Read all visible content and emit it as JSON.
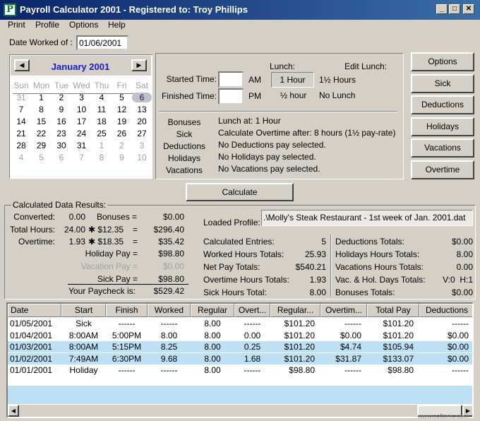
{
  "window": {
    "title": "Payroll Calculator 2001 - Registered to: Troy Phillips",
    "logo": "P"
  },
  "menu": [
    "Print",
    "Profile",
    "Options",
    "Help"
  ],
  "date_worked": {
    "label": "Date Worked of :",
    "value": "01/06/2001"
  },
  "calendar": {
    "month": "January 2001",
    "days_of_week": [
      "Sun",
      "Mon",
      "Tue",
      "Wed",
      "Thu",
      "Fri",
      "Sat"
    ],
    "weeks": [
      [
        "31",
        "1",
        "2",
        "3",
        "4",
        "5",
        "6"
      ],
      [
        "7",
        "8",
        "9",
        "10",
        "11",
        "12",
        "13"
      ],
      [
        "14",
        "15",
        "16",
        "17",
        "18",
        "19",
        "20"
      ],
      [
        "21",
        "22",
        "23",
        "24",
        "25",
        "26",
        "27"
      ],
      [
        "28",
        "29",
        "30",
        "31",
        "1",
        "2",
        "3"
      ],
      [
        "4",
        "5",
        "6",
        "7",
        "8",
        "9",
        "10"
      ]
    ],
    "selected": "6"
  },
  "time": {
    "started_label": "Started Time:",
    "finished_label": "Finished Time:",
    "am": "AM",
    "pm": "PM",
    "started_value": "",
    "finished_value": "",
    "lunch_label": "Lunch:",
    "edit_lunch_label": "Edit Lunch:",
    "lunch_options": [
      "1 Hour",
      "1½ Hours",
      "½ hour",
      "No Lunch"
    ]
  },
  "summary": {
    "labels": [
      "Bonuses",
      "Sick",
      "Deductions",
      "Holidays",
      "Vacations"
    ],
    "lines": [
      "Lunch at: 1 Hour",
      "Calculate Overtime after: 8 hours (1½ pay-rate)",
      "No Deductions pay selected.",
      "No Holidays pay selected.",
      "No Vacations pay selected."
    ]
  },
  "side_buttons": [
    "Options",
    "Sick",
    "Deductions",
    "Holidays",
    "Vacations",
    "Overtime"
  ],
  "calculate_label": "Calculate",
  "results": {
    "title": "Calculated Data Results:",
    "converted_label": "Converted:",
    "converted": "0.00",
    "bonuses_label": "Bonuses =",
    "bonuses": "$0.00",
    "total_hours_label": "Total Hours:",
    "total_hours": "24.00",
    "rate": "✱ $12.35",
    "eq": "=",
    "total_hours_pay": "$296.40",
    "overtime_label": "Overtime:",
    "overtime": "1.93",
    "ot_rate": "✱ $18.35",
    "overtime_pay": "$35.42",
    "holiday_label": "Holiday Pay =",
    "holiday": "$98.80",
    "vacation_label": "Vacation Pay =",
    "vacation": "$0.00",
    "sick_label": "Sick Pay =",
    "sick": "$98.80",
    "paycheck_label": "Your Paycheck is:",
    "paycheck": "$529.42"
  },
  "profile": {
    "label": "Loaded Profile:",
    "value": ".\\Molly's Steak Restaurant - 1st week of Jan. 2001.dat"
  },
  "totals_left": [
    [
      "Calculated Entries:",
      "5"
    ],
    [
      "Worked Hours Totals:",
      "25.93"
    ],
    [
      "Net Pay Totals:",
      "$540.21"
    ],
    [
      "Overtime Hours Totals:",
      "1.93"
    ],
    [
      "Sick Hours Total:",
      "8.00"
    ]
  ],
  "totals_right": [
    [
      "Deductions Totals:",
      "$0.00"
    ],
    [
      "Holidays Hours Totals:",
      "8.00"
    ],
    [
      "Vacations Hours Totals:",
      "0.00"
    ],
    [
      "Vac. & Hol. Days Totals:",
      "V:0  H:1"
    ],
    [
      "Bonuses Totals:",
      "$0.00"
    ]
  ],
  "table": {
    "columns": [
      "Date",
      "Start",
      "Finish",
      "Worked",
      "Regular",
      "Overt...",
      "Regular...",
      "Overtim...",
      "Total Pay",
      "Deductions"
    ],
    "rows": [
      [
        "01/05/2001",
        "Sick",
        "------",
        "------",
        "8.00",
        "------",
        "$101.20",
        "------",
        "$101.20",
        "------"
      ],
      [
        "01/04/2001",
        "8:00AM",
        "5:00PM",
        "8.00",
        "8.00",
        "0.00",
        "$101.20",
        "$0.00",
        "$101.20",
        "$0.00"
      ],
      [
        "01/03/2001",
        "8:00AM",
        "5:15PM",
        "8.25",
        "8.00",
        "0.25",
        "$101.20",
        "$4.74",
        "$105.94",
        "$0.00"
      ],
      [
        "01/02/2001",
        "7:49AM",
        "6:30PM",
        "9.68",
        "8.00",
        "1.68",
        "$101.20",
        "$31.87",
        "$133.07",
        "$0.00"
      ],
      [
        "01/01/2001",
        "Holiday",
        "------",
        "------",
        "8.00",
        "------",
        "$98.80",
        "------",
        "$98.80",
        "------"
      ]
    ]
  },
  "watermark": "www.softonic.com",
  "colors": {
    "title_bar": "#0a246a",
    "month": "#1a1acc",
    "row_highlight": "#bde0f4"
  }
}
